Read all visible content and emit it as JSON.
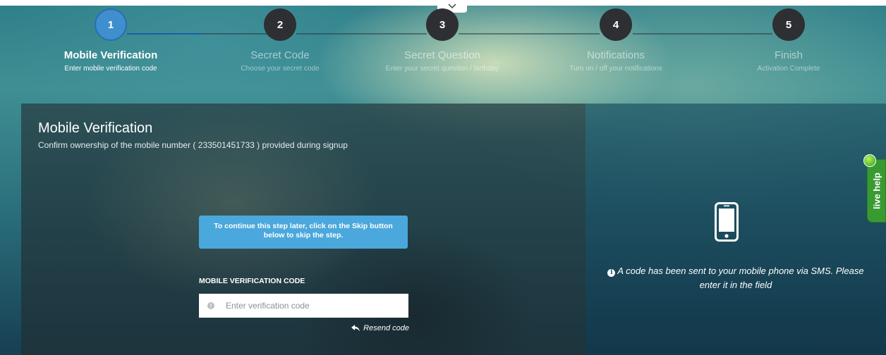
{
  "wizard": {
    "steps": [
      {
        "number": "1",
        "title": "Mobile Verification",
        "subtitle": "Enter mobile verification code"
      },
      {
        "number": "2",
        "title": "Secret Code",
        "subtitle": "Choose your secret code"
      },
      {
        "number": "3",
        "title": "Secret Question",
        "subtitle": "Enter your secret question / birthday"
      },
      {
        "number": "4",
        "title": "Notifications",
        "subtitle": "Turn on / off your notifications"
      },
      {
        "number": "5",
        "title": "Finish",
        "subtitle": "Activation Complete"
      }
    ],
    "active_step": 1
  },
  "verification": {
    "title": "Mobile Verification",
    "subtitle": "Confirm ownership of the mobile number ( 233501451733 ) provided during signup",
    "notice_prefix": "To continue this step later, click on the ",
    "notice_bold": "Skip",
    "notice_suffix": " button below to skip the step.",
    "field_label": "MOBILE VERIFICATION CODE",
    "input_placeholder": "Enter verification code",
    "input_value": "",
    "resend_label": "Resend code"
  },
  "sidebar": {
    "sms_message": "A code has been sent to your mobile phone via SMS. Please enter it in the field"
  },
  "live_help": {
    "label": "live help",
    "color": "#3a9a32"
  },
  "icons": {
    "collapse": "chevron-down-icon",
    "input": "info-icon",
    "resend": "reply-icon",
    "phone": "mobile-phone-icon",
    "sms": "info-circle-icon"
  }
}
